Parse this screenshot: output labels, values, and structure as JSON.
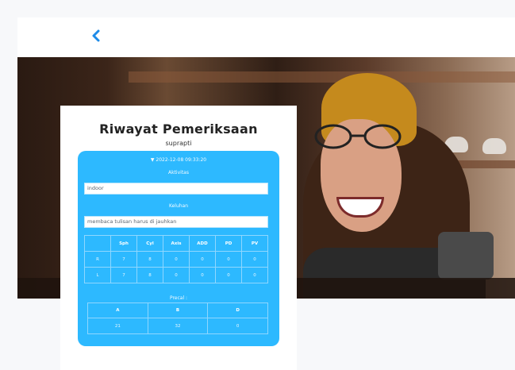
{
  "header": {
    "back_icon": "chevron-left-icon"
  },
  "hero": {
    "alt": "woman-with-glasses-photo"
  },
  "record": {
    "title": "Riwayat Pemeriksaan",
    "patient_name": "suprapti",
    "datetime": "▼ 2022-12-08 09:33:20",
    "activity_label": "Aktivitas",
    "activity_value": "indoor",
    "complaint_label": "Keluhan",
    "complaint_value": "membaca tulisan harus di jauhkan",
    "measure_headers": [
      "",
      "Sph",
      "Cyl",
      "Axis",
      "ADD",
      "PD",
      "PV"
    ],
    "measure_rows": [
      {
        "eye": "R",
        "sph": "7",
        "cyl": "8",
        "axis": "0",
        "add": "0",
        "pd": "0",
        "pv": "0"
      },
      {
        "eye": "L",
        "sph": "7",
        "cyl": "8",
        "axis": "0",
        "add": "0",
        "pd": "0",
        "pv": "0"
      }
    ],
    "precal_label": "Precal :",
    "precal_headers": [
      "A",
      "B",
      "D"
    ],
    "precal_values": [
      "21",
      "32",
      "0"
    ]
  },
  "colors": {
    "panel": "#2db9ff",
    "card": "#ffffff",
    "back": "#1e8be8"
  }
}
